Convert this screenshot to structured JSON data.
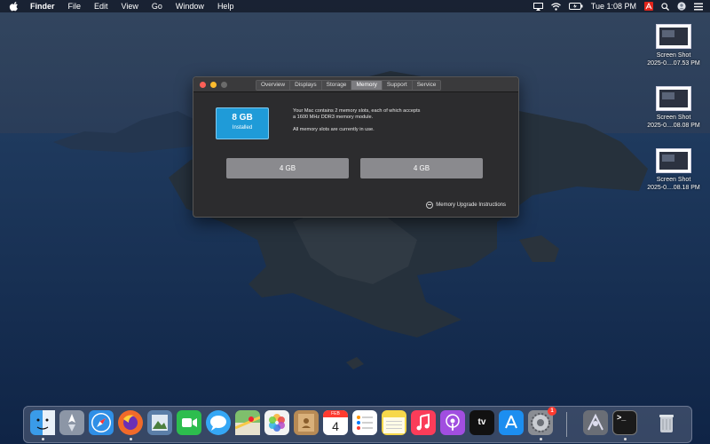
{
  "menubar": {
    "app_name": "Finder",
    "items": [
      "File",
      "Edit",
      "View",
      "Go",
      "Window",
      "Help"
    ],
    "clock": "Tue 1:08 PM",
    "status_icons": [
      "cast-icon",
      "wifi-icon",
      "battery-icon",
      "adobe-icon",
      "search-icon",
      "user-icon",
      "list-icon"
    ]
  },
  "desktop_items": [
    {
      "title": "Screen Shot",
      "subtitle": "2025-0....07.53 PM"
    },
    {
      "title": "Screen Shot",
      "subtitle": "2025-0....08.08 PM"
    },
    {
      "title": "Screen Shot",
      "subtitle": "2025-0....08.18 PM"
    }
  ],
  "about_window": {
    "tabs": [
      {
        "label": "Overview",
        "active": false
      },
      {
        "label": "Displays",
        "active": false
      },
      {
        "label": "Storage",
        "active": false
      },
      {
        "label": "Memory",
        "active": true
      },
      {
        "label": "Support",
        "active": false
      },
      {
        "label": "Service",
        "active": false
      }
    ],
    "installed_size": "8 GB",
    "installed_label": "Installed",
    "info_line1": "Your Mac contains 2 memory slots, each of which accepts",
    "info_line2": "a 1600 MHz DDR3 memory module.",
    "info_line3": "All memory slots are currently in use.",
    "slots": [
      "4 GB",
      "4 GB"
    ],
    "upgrade_link": "Memory Upgrade Instructions"
  },
  "dock": {
    "apps": [
      {
        "name": "finder-icon",
        "color": "#3a9be8"
      },
      {
        "name": "launchpad-icon",
        "color": "#8c96a6"
      },
      {
        "name": "safari-icon",
        "color": "#2f8fe6"
      },
      {
        "name": "firefox-icon",
        "color": "#f06a2a"
      },
      {
        "name": "preview-icon",
        "color": "#5b7ea8"
      },
      {
        "name": "facetime-icon",
        "color": "#2dbd4e"
      },
      {
        "name": "messages-icon",
        "color": "#35a7f5"
      },
      {
        "name": "maps-icon",
        "color": "#7fbf6c"
      },
      {
        "name": "photos-icon",
        "color": "#f3f3f3"
      },
      {
        "name": "contacts-icon",
        "color": "#b78a55"
      },
      {
        "name": "calendar-icon",
        "color": "#ffffff"
      },
      {
        "name": "reminders-icon",
        "color": "#ffffff"
      },
      {
        "name": "notes-icon",
        "color": "#f7d84a"
      },
      {
        "name": "music-icon",
        "color": "#fb3c59"
      },
      {
        "name": "podcasts-icon",
        "color": "#a14ee0"
      },
      {
        "name": "tv-icon",
        "color": "#111111"
      },
      {
        "name": "app-store-icon",
        "color": "#1c8ef0"
      },
      {
        "name": "system-preferences-icon",
        "color": "#8a8d93"
      },
      {
        "name": "utility-icon",
        "color": "#6a6e76"
      },
      {
        "name": "terminal-icon",
        "color": "#1a1a1a"
      },
      {
        "name": "trash-icon",
        "color": "#c7ccd4"
      }
    ],
    "calendar_month": "FEB",
    "calendar_day": "4",
    "system_prefs_badge": "1",
    "tv_label": "tv",
    "terminal_prompt": ">_"
  }
}
